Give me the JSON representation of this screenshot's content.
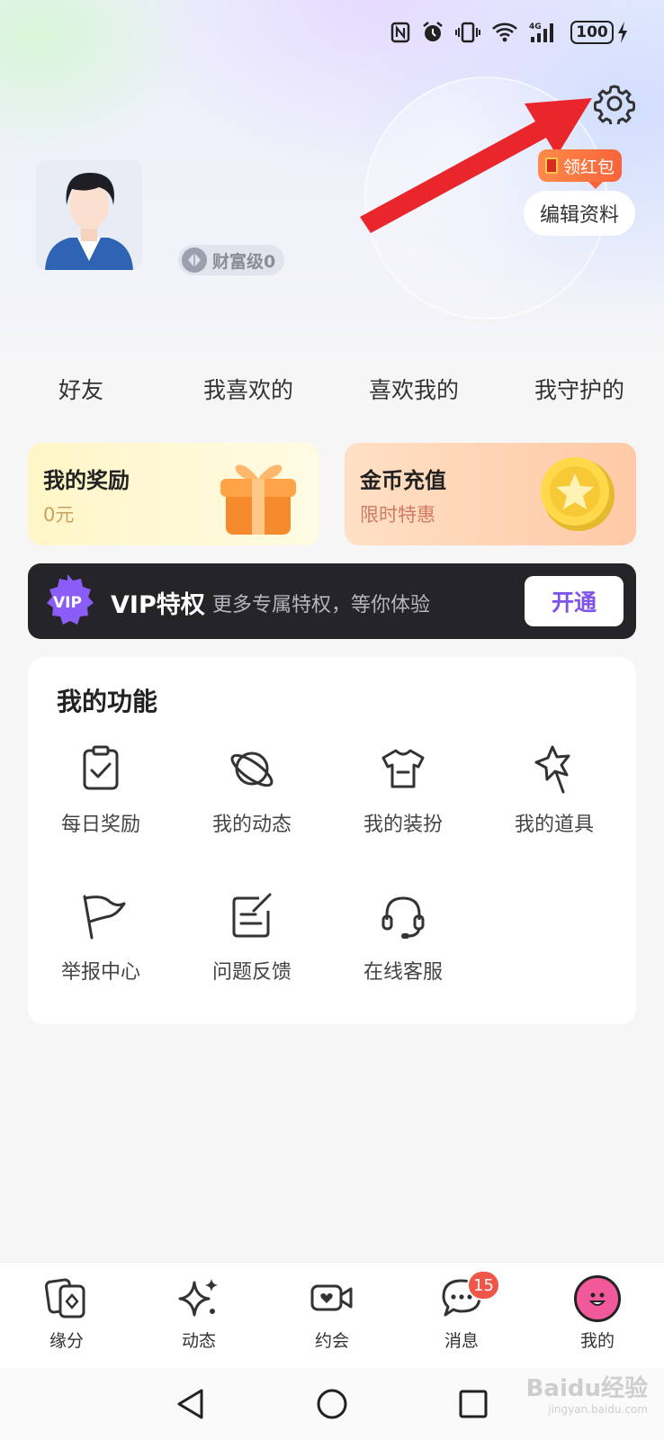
{
  "status_bar": {
    "battery": "100"
  },
  "profile": {
    "wealth_level": "财富级0",
    "red_packet": "领红包",
    "edit_profile": "编辑资料"
  },
  "stats": [
    {
      "label": "好友"
    },
    {
      "label": "我喜欢的"
    },
    {
      "label": "喜欢我的"
    },
    {
      "label": "我守护的"
    }
  ],
  "cards": {
    "reward": {
      "title": "我的奖励",
      "value": "0元"
    },
    "coins": {
      "title": "金币充值",
      "subtitle": "限时特惠"
    }
  },
  "vip": {
    "badge": "VIP",
    "title": "VIP特权",
    "description": "更多专属特权，等你体验",
    "button": "开通"
  },
  "functions": {
    "title": "我的功能",
    "items": [
      {
        "label": "每日奖励",
        "icon": "clipboard-check-icon"
      },
      {
        "label": "我的动态",
        "icon": "planet-icon"
      },
      {
        "label": "我的装扮",
        "icon": "tshirt-icon"
      },
      {
        "label": "我的道具",
        "icon": "magic-wand-star-icon"
      },
      {
        "label": "举报中心",
        "icon": "flag-icon"
      },
      {
        "label": "问题反馈",
        "icon": "edit-note-icon"
      },
      {
        "label": "在线客服",
        "icon": "headset-icon"
      }
    ]
  },
  "bottom_nav": [
    {
      "label": "缘分",
      "icon": "cards-icon"
    },
    {
      "label": "动态",
      "icon": "sparkle-icon"
    },
    {
      "label": "约会",
      "icon": "video-heart-icon"
    },
    {
      "label": "消息",
      "icon": "chat-bubble-icon",
      "badge": "15"
    },
    {
      "label": "我的",
      "icon": "smiley-avatar-icon",
      "active": true
    }
  ],
  "watermark": {
    "brand": "Baidu经验",
    "url": "jingyan.baidu.com"
  },
  "colors": {
    "vip_accent": "#7f53e8",
    "red_packet": "#f7643a",
    "badge": "#f0554a",
    "annotation_arrow": "#e8262b"
  }
}
